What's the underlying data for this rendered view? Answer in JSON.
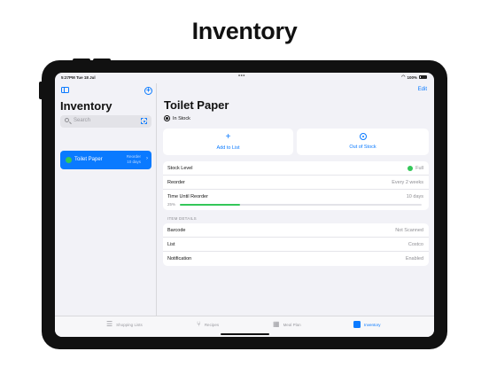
{
  "headline": "Inventory",
  "status_bar": {
    "time": "5:27PM  Tue 18 Jul",
    "battery": "100%"
  },
  "sidebar": {
    "title": "Inventory",
    "search_placeholder": "Search",
    "items": [
      {
        "name": "Toilet Paper",
        "subtitle": "Reorder 10 days",
        "selected": true
      }
    ]
  },
  "detail": {
    "edit_label": "Edit",
    "title": "Toilet Paper",
    "status": "In Stock",
    "actions": [
      {
        "label": "Add to List",
        "icon": "plus-icon"
      },
      {
        "label": "Out of Stock",
        "icon": "target-icon"
      }
    ],
    "stock": {
      "stock_level_label": "Stock Level",
      "stock_level_value": "Full",
      "reorder_label": "Reorder",
      "reorder_value": "Every 2 weeks",
      "time_until_label": "Time Until Reorder",
      "time_until_value": "10 days",
      "progress_label": "25%",
      "progress": 0.25
    },
    "section_header": "ITEM DETAILS",
    "item_details": [
      {
        "label": "Barcode",
        "value": "Not Scanned"
      },
      {
        "label": "List",
        "value": "Costco"
      },
      {
        "label": "Notification",
        "value": "Enabled"
      }
    ]
  },
  "tabs": [
    {
      "label": "Shopping Lists",
      "icon": "list-icon",
      "active": false
    },
    {
      "label": "Recipes",
      "icon": "fork-knife-icon",
      "active": false
    },
    {
      "label": "Meal Plan",
      "icon": "calendar-icon",
      "active": false
    },
    {
      "label": "Inventory",
      "icon": "box-icon",
      "active": true
    }
  ],
  "colors": {
    "accent": "#0a7aff",
    "success": "#34c759",
    "background": "#f2f2f7"
  }
}
